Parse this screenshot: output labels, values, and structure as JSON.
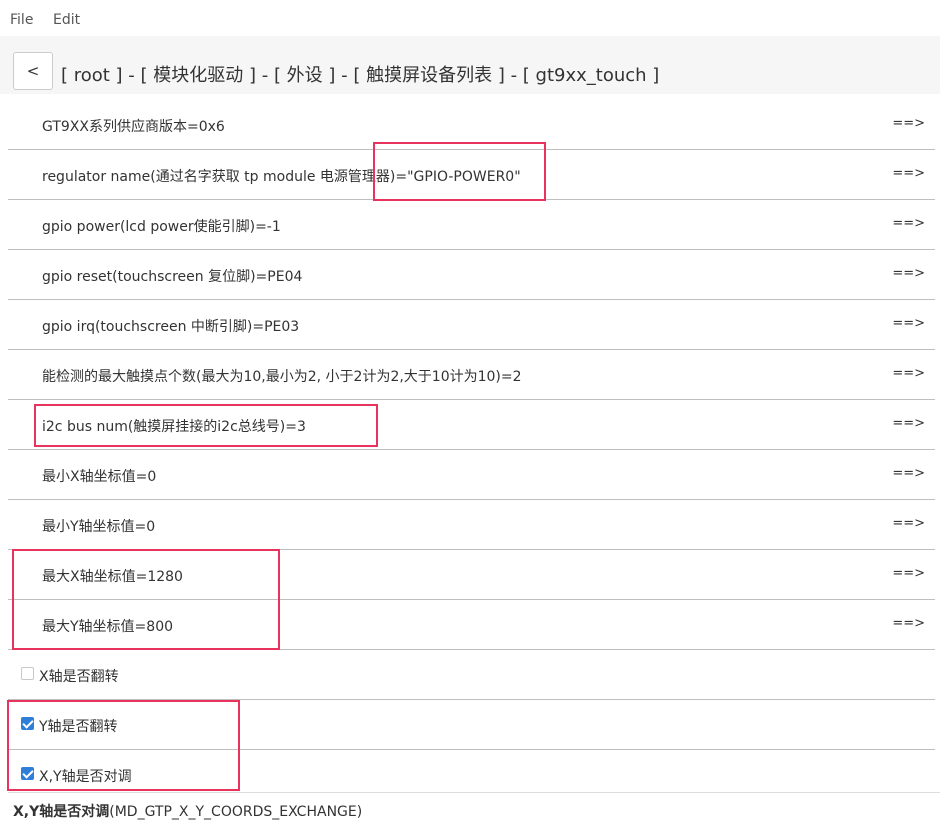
{
  "menu": {
    "file": "File",
    "edit": "Edit"
  },
  "header": {
    "back_label": "<",
    "breadcrumb": "[ root ] - [ 模块化驱动 ] - [ 外设 ] - [ 触摸屏设备列表 ] - [ gt9xx_touch ]"
  },
  "rows": [
    {
      "label": "GT9XX系列供应商版本=0x6",
      "arrow": "==>"
    },
    {
      "label": "regulator name(通过名字获取 tp module 电源管理器)=\"GPIO-POWER0\"",
      "arrow": "==>"
    },
    {
      "label": "gpio power(lcd power使能引脚)=-1",
      "arrow": "==>"
    },
    {
      "label": "gpio reset(touchscreen 复位脚)=PE04",
      "arrow": "==>"
    },
    {
      "label": "gpio irq(touchscreen 中断引脚)=PE03",
      "arrow": "==>"
    },
    {
      "label": "能检测的最大触摸点个数(最大为10,最小为2, 小于2计为2,大于10计为10)=2",
      "arrow": "==>"
    },
    {
      "label": "i2c bus num(触摸屏挂接的i2c总线号)=3",
      "arrow": "==>"
    },
    {
      "label": "最小X轴坐标值=0",
      "arrow": "==>"
    },
    {
      "label": "最小Y轴坐标值=0",
      "arrow": "==>"
    },
    {
      "label": "最大X轴坐标值=1280",
      "arrow": "==>"
    },
    {
      "label": "最大Y轴坐标值=800",
      "arrow": "==>"
    }
  ],
  "checkboxes": [
    {
      "label": "X轴是否翻转",
      "checked": false
    },
    {
      "label": "Y轴是否翻转",
      "checked": true
    },
    {
      "label": "X,Y轴是否对调",
      "checked": true
    }
  ],
  "status": {
    "title": "X,Y轴是否对调",
    "symbol": "(MD_GTP_X_Y_COORDS_EXCHANGE)"
  },
  "colors": {
    "highlight": "#e8335c",
    "checkbox_checked": "#2f7fd8"
  }
}
